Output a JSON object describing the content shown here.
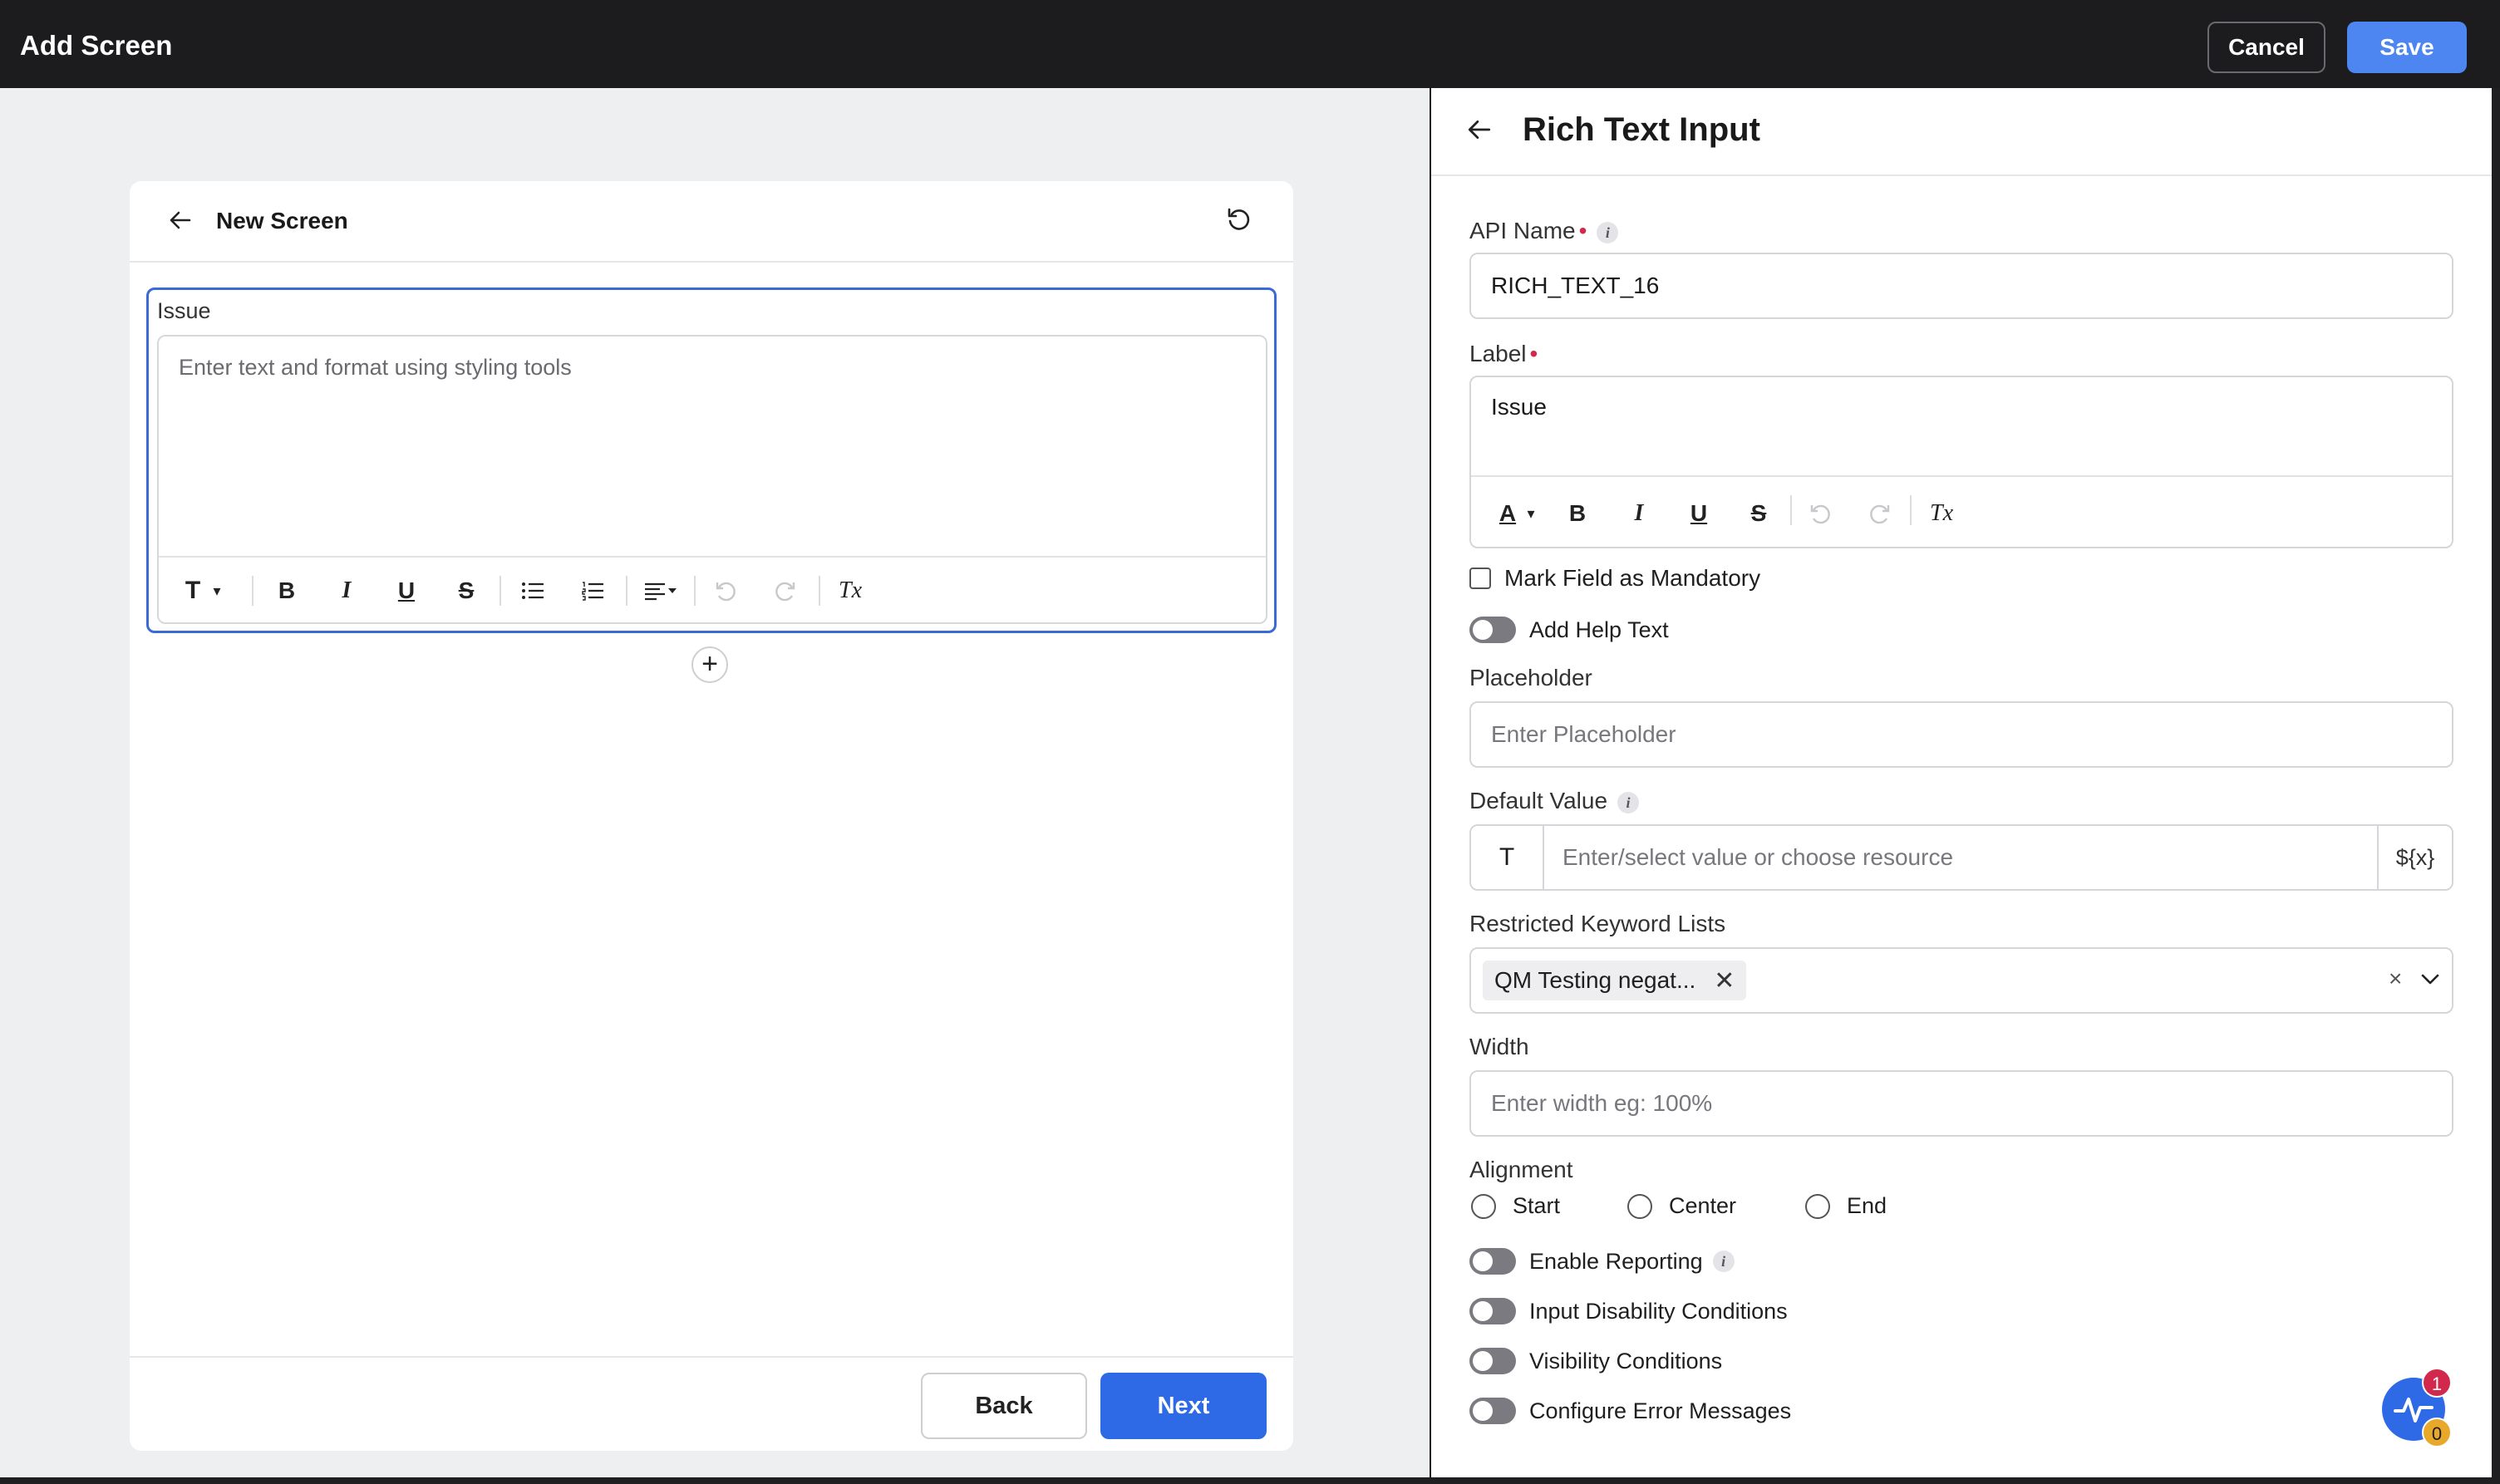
{
  "topbar": {
    "title": "Add Screen",
    "cancel_label": "Cancel",
    "save_label": "Save"
  },
  "preview": {
    "title": "New Screen",
    "field_label": "Issue",
    "editor_placeholder": "Enter text and format using styling tools",
    "toolbar": {
      "text_style": "T",
      "bold": "B",
      "italic": "I",
      "underline": "U",
      "strike": "S",
      "clear_format": "Tx"
    },
    "add_symbol": "+",
    "back_label": "Back",
    "next_label": "Next"
  },
  "panel": {
    "title": "Rich Text Input",
    "api_name_label": "API Name",
    "api_name_value": "RICH_TEXT_16",
    "label_label": "Label",
    "label_value": "Issue",
    "label_toolbar": {
      "color": "A",
      "bold": "B",
      "italic": "I",
      "underline": "U",
      "strike": "S",
      "clear_format": "Tx"
    },
    "mandatory_label": "Mark Field as Mandatory",
    "help_text_label": "Add Help Text",
    "placeholder_label": "Placeholder",
    "placeholder_input": "Enter Placeholder",
    "default_value_label": "Default Value",
    "default_type": "T",
    "default_input": "Enter/select value or choose resource",
    "default_resource": "${x}",
    "keyword_label": "Restricted Keyword Lists",
    "keyword_chip": "QM Testing negat...",
    "width_label": "Width",
    "width_input": "Enter width eg: 100%",
    "alignment_label": "Alignment",
    "alignment_options": [
      "Start",
      "Center",
      "End"
    ],
    "enable_reporting_label": "Enable Reporting",
    "disability_label": "Input Disability Conditions",
    "visibility_label": "Visibility Conditions",
    "error_messages_label": "Configure Error Messages"
  },
  "fab": {
    "badge_top": "1",
    "badge_bottom": "0"
  },
  "colors": {
    "accent": "#2f6ae6",
    "save": "#4d86f0",
    "required": "#d1284b",
    "topbar": "#1c1c1e"
  }
}
